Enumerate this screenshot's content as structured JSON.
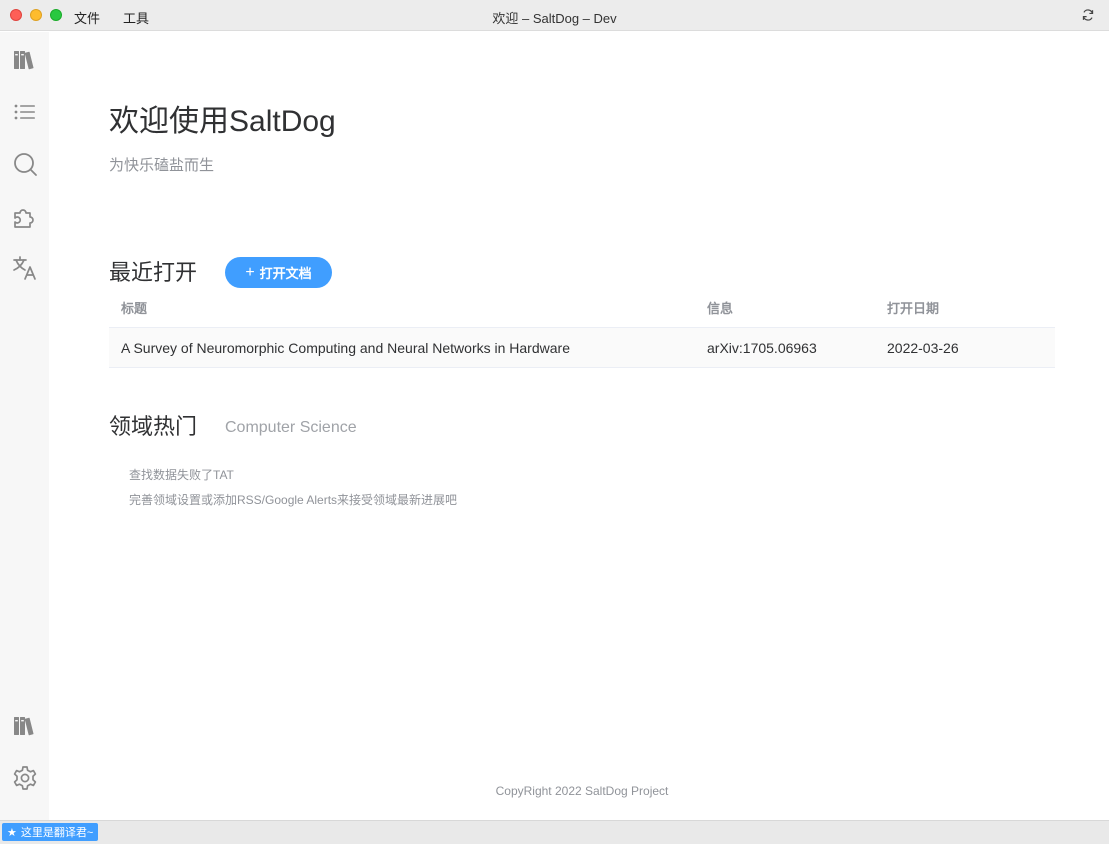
{
  "titlebar": {
    "menu": [
      "文件",
      "工具"
    ],
    "title": "欢迎 – SaltDog – Dev"
  },
  "sidebar": {
    "icons": [
      "library-icon",
      "list-icon",
      "search-icon",
      "puzzle-icon",
      "translate-icon",
      "library-icon",
      "gear-icon"
    ]
  },
  "main": {
    "title": "欢迎使用SaltDog",
    "subtitle": "为快乐磕盐而生",
    "recent": {
      "title": "最近打开",
      "open_button": "打开文档",
      "columns": [
        "标题",
        "信息",
        "打开日期"
      ],
      "rows": [
        {
          "title": "A Survey of Neuromorphic Computing and Neural Networks in Hardware",
          "info": "arXiv:1705.06963",
          "date": "2022-03-26"
        }
      ]
    },
    "hot": {
      "title": "领域热门",
      "domain": "Computer Science",
      "empty_line1": "查找数据失败了TAT",
      "empty_line2": "完善领域设置或添加RSS/Google Alerts来接受领域最新进展吧"
    },
    "copyright": "CopyRight 2022 SaltDog Project"
  },
  "statusbar": {
    "translator_label": "这里是翻译君~"
  },
  "colors": {
    "accent": "#409eff",
    "sidebar_bg": "#f7f7f7",
    "icon": "#8a8a8a"
  }
}
